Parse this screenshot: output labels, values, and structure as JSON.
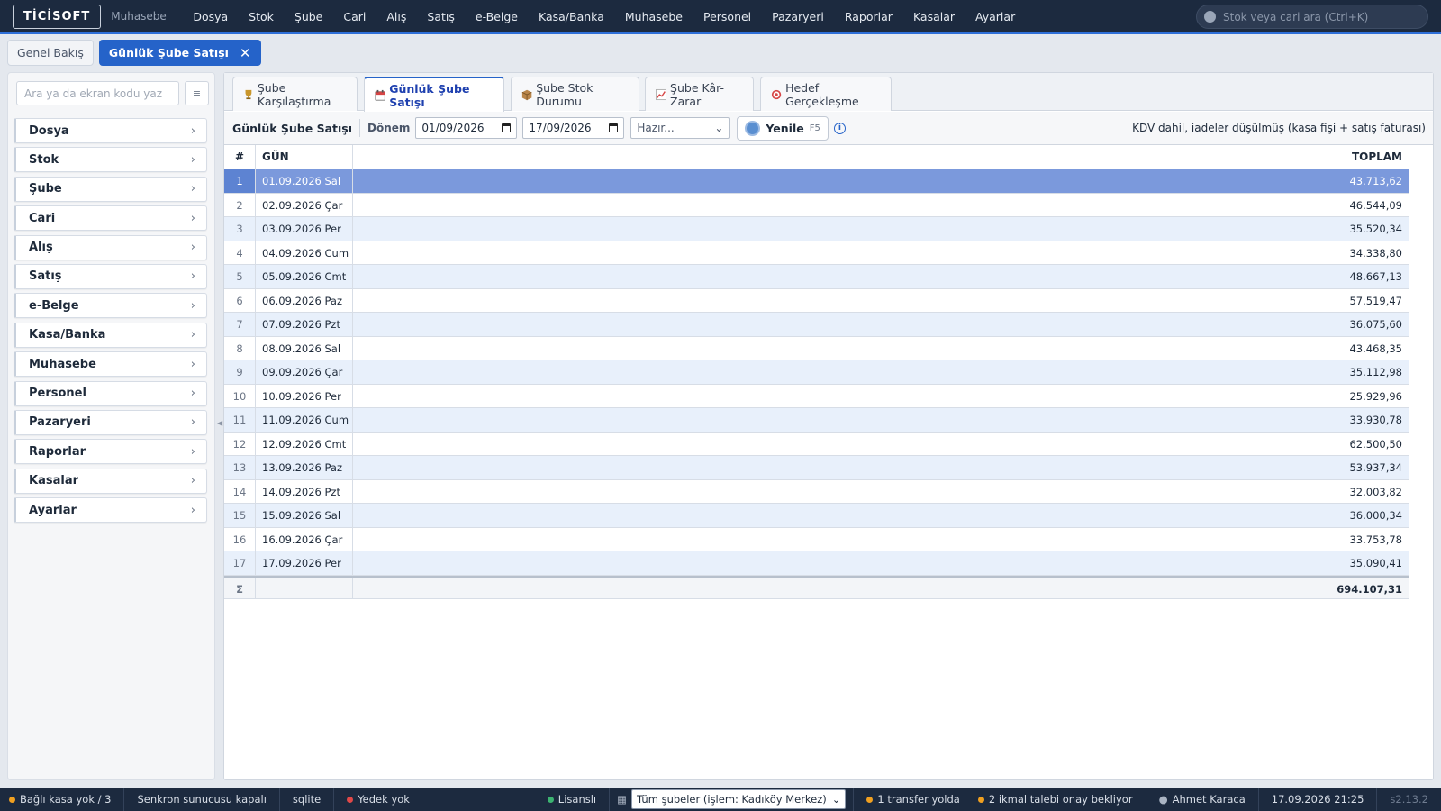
{
  "app": {
    "logo": "TİCİSOFT",
    "subtitle": "Muhasebe"
  },
  "topnav": [
    "Dosya",
    "Stok",
    "Şube",
    "Cari",
    "Alış",
    "Satış",
    "e-Belge",
    "Kasa/Banka",
    "Muhasebe",
    "Personel",
    "Pazaryeri",
    "Raporlar",
    "Kasalar",
    "Ayarlar"
  ],
  "search": {
    "placeholder": "Stok veya cari ara (Ctrl+K)"
  },
  "doctabs": {
    "overview": "Genel Bakış",
    "active": "Günlük Şube Satışı",
    "close": "✕"
  },
  "sidebar": {
    "search_placeholder": "Ara ya da ekran kodu yaz",
    "toggle_icon": "≡",
    "items": [
      "Dosya",
      "Stok",
      "Şube",
      "Cari",
      "Alış",
      "Satış",
      "e-Belge",
      "Kasa/Banka",
      "Muhasebe",
      "Personel",
      "Pazaryeri",
      "Raporlar",
      "Kasalar",
      "Ayarlar"
    ]
  },
  "module_tabs": [
    {
      "label": "Şube Karşılaştırma",
      "icon": "trophy-icon",
      "color": "#c9962b"
    },
    {
      "label": "Günlük Şube Satışı",
      "icon": "calendar-icon",
      "color": "#d64545"
    },
    {
      "label": "Şube Stok Durumu",
      "icon": "package-icon",
      "color": "#a0713c"
    },
    {
      "label": "Şube Kâr-Zarar",
      "icon": "chart-up-icon",
      "color": "#d64545"
    },
    {
      "label": "Hedef Gerçekleşme",
      "icon": "target-icon",
      "color": "#d64545"
    }
  ],
  "toolbar": {
    "title": "Günlük Şube Satışı",
    "period_label": "Dönem",
    "date_from": "01/09/2026",
    "date_to": "17/09/2026",
    "preset": "Hazır...",
    "refresh": "Yenile",
    "refresh_key": "F5",
    "info": "i",
    "note": "KDV dahil, iadeler düşülmüş (kasa fişi + satış faturası)"
  },
  "grid": {
    "headers": {
      "num": "#",
      "day": "GÜN",
      "total": "TOPLAM"
    },
    "rows": [
      {
        "num": "1",
        "day": "01.09.2026 Sal",
        "total": "43.713,62"
      },
      {
        "num": "2",
        "day": "02.09.2026 Çar",
        "total": "46.544,09"
      },
      {
        "num": "3",
        "day": "03.09.2026 Per",
        "total": "35.520,34"
      },
      {
        "num": "4",
        "day": "04.09.2026 Cum",
        "total": "34.338,80"
      },
      {
        "num": "5",
        "day": "05.09.2026 Cmt",
        "total": "48.667,13"
      },
      {
        "num": "6",
        "day": "06.09.2026 Paz",
        "total": "57.519,47"
      },
      {
        "num": "7",
        "day": "07.09.2026 Pzt",
        "total": "36.075,60"
      },
      {
        "num": "8",
        "day": "08.09.2026 Sal",
        "total": "43.468,35"
      },
      {
        "num": "9",
        "day": "09.09.2026 Çar",
        "total": "35.112,98"
      },
      {
        "num": "10",
        "day": "10.09.2026 Per",
        "total": "25.929,96"
      },
      {
        "num": "11",
        "day": "11.09.2026 Cum",
        "total": "33.930,78"
      },
      {
        "num": "12",
        "day": "12.09.2026 Cmt",
        "total": "62.500,50"
      },
      {
        "num": "13",
        "day": "13.09.2026 Paz",
        "total": "53.937,34"
      },
      {
        "num": "14",
        "day": "14.09.2026 Pzt",
        "total": "32.003,82"
      },
      {
        "num": "15",
        "day": "15.09.2026 Sal",
        "total": "36.000,34"
      },
      {
        "num": "16",
        "day": "16.09.2026 Çar",
        "total": "33.753,78"
      },
      {
        "num": "17",
        "day": "17.09.2026 Per",
        "total": "35.090,41"
      }
    ],
    "total_symbol": "Σ",
    "grand_total": "694.107,31"
  },
  "statusbar": {
    "kasa": "Bağlı kasa yok / 3",
    "sync": "Senkron sunucusu kapalı",
    "db": "sqlite",
    "backup": "Yedek yok",
    "license": "Lisanslı",
    "branch_select": "Tüm şubeler (işlem: Kadıköy Merkez)",
    "transfer": "1 transfer yolda",
    "requests": "2 ikmal talebi onay bekliyor",
    "user": "Ahmet Karaca",
    "datetime": "17.09.2026 21:25",
    "version": "s2.13.2"
  },
  "colors": {
    "accent": "#2563c9",
    "topbar": "#1c2a3f",
    "selected_row": "#7b99dc",
    "alt_row": "#e8f0fb",
    "dot_orange": "#f0a020",
    "dot_red": "#e04848",
    "dot_green": "#3cb371"
  }
}
